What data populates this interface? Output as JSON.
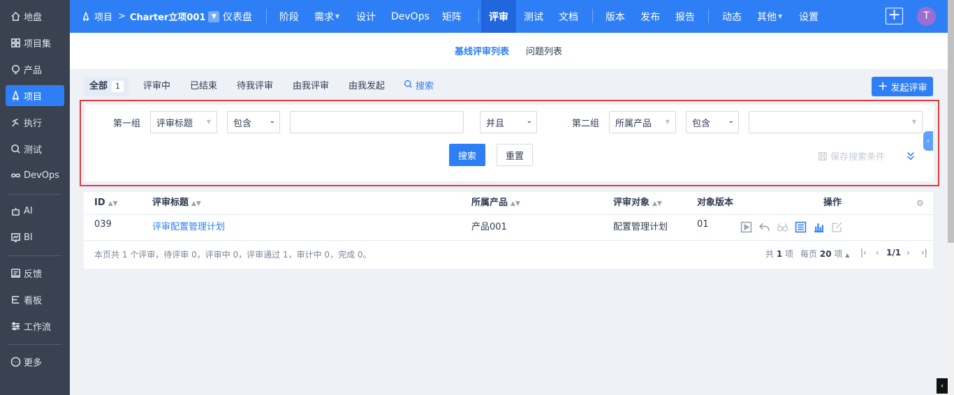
{
  "sidebar": {
    "items": [
      {
        "label": "地盘",
        "icon": "home-icon"
      },
      {
        "label": "项目集",
        "icon": "grid-icon"
      },
      {
        "label": "产品",
        "icon": "bulb-icon"
      },
      {
        "label": "项目",
        "icon": "rocket-icon",
        "active": true
      },
      {
        "label": "执行",
        "icon": "run-icon"
      },
      {
        "label": "测试",
        "icon": "magnifier-test-icon"
      },
      {
        "label": "DevOps",
        "icon": "infinity-icon"
      },
      {
        "label": "AI",
        "icon": "robot-icon"
      },
      {
        "label": "BI",
        "icon": "chart-board-icon"
      },
      {
        "label": "反馈",
        "icon": "feedback-icon"
      },
      {
        "label": "看板",
        "icon": "kanban-icon"
      },
      {
        "label": "工作流",
        "icon": "workflow-icon"
      },
      {
        "label": "更多",
        "icon": "more-icon"
      }
    ]
  },
  "topnav": {
    "breadcrumb_root": "项目",
    "breadcrumb_sep": ">",
    "project_name": "Charter立项001",
    "items": [
      "仪表盘",
      "阶段",
      "需求",
      "设计",
      "DevOps",
      "矩阵",
      "评审",
      "测试",
      "文档",
      "版本",
      "发布",
      "报告",
      "动态",
      "其他",
      "设置"
    ],
    "active": "评审",
    "avatar_letter": "T"
  },
  "subnav": {
    "tabs": [
      "基线评审列表",
      "问题列表"
    ],
    "active": "基线评审列表"
  },
  "filters": {
    "tabs": [
      {
        "label": "全部",
        "count": "1"
      },
      {
        "label": "评审中"
      },
      {
        "label": "已结束"
      },
      {
        "label": "待我评审"
      },
      {
        "label": "由我评审"
      },
      {
        "label": "由我发起"
      }
    ],
    "search_label": "搜索",
    "create_button": "发起评审"
  },
  "search_panel": {
    "group1_label": "第一组",
    "group1_field": "评审标题",
    "group1_operator": "包含",
    "group1_value": "",
    "logic": "并且",
    "group2_label": "第二组",
    "group2_field": "所属产品",
    "group2_operator": "包含",
    "group2_value": "",
    "search_button": "搜索",
    "reset_button": "重置",
    "save_condition": "保存搜索条件"
  },
  "table": {
    "columns": [
      "ID",
      "评审标题",
      "所属产品",
      "评审对象",
      "对象版本",
      "操作"
    ],
    "rows": [
      {
        "id": "039",
        "title": "评审配置管理计划",
        "product": "产品001",
        "object": "配置管理计划",
        "version": "01"
      }
    ],
    "summary": "本页共 1 个评审，待评审 0，评审中 0，评审通过 1，审计中 0，完成 0。",
    "pager": {
      "total_prefix": "共",
      "total": "1",
      "total_suffix": "项",
      "per_page_prefix": "每页",
      "per_page": "20",
      "per_page_suffix": "项",
      "page": "1/1"
    }
  },
  "colors": {
    "primary": "#2e7ff5",
    "sidebar_bg": "#3a4252",
    "highlight_border": "#e03a3a",
    "avatar_bg": "#9b6ed1"
  }
}
